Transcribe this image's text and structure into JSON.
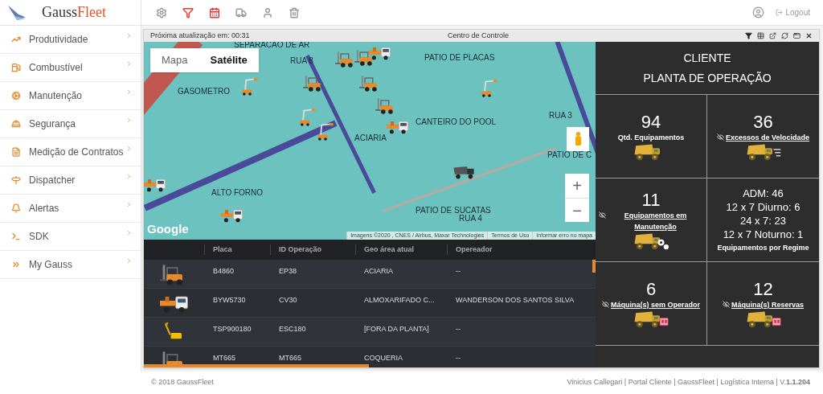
{
  "brand": {
    "name_first": "Gauss",
    "name_second": "Fleet"
  },
  "toolbar_icons": [
    {
      "active": false
    },
    {
      "active": true
    },
    {
      "active": true
    },
    {
      "active": false
    },
    {
      "active": false
    },
    {
      "active": false
    }
  ],
  "logout": "Logout",
  "sidebar": {
    "items": [
      {
        "label": "Produtividade"
      },
      {
        "label": "Combustível"
      },
      {
        "label": "Manutenção"
      },
      {
        "label": "Segurança"
      },
      {
        "label": "Medição de Contratos"
      },
      {
        "label": "Dispatcher"
      },
      {
        "label": "Alertas"
      },
      {
        "label": "SDK"
      },
      {
        "label": "My Gauss"
      }
    ]
  },
  "window": {
    "countdown": "Próxima atualização em: 00:31",
    "title": "Centro de Controle"
  },
  "map": {
    "types": [
      {
        "label": "Mapa",
        "selected": false
      },
      {
        "label": "Satélite",
        "selected": true
      }
    ],
    "labels": [
      "SEPARACAO DE AR",
      "RUA 8",
      "PATIO DE PLACAS",
      "GASOMETRO",
      "CANTEIRO DO POOL",
      "ACIARIA",
      "RUA 3",
      "PATIO DE C",
      "ALTO FORNO",
      "PATIO DE SUCATAS",
      "RUA 4"
    ],
    "zoom_in": "+",
    "zoom_out": "−",
    "logo": "Google",
    "attribution": [
      "Imagens ©2020 , CNES / Airbus, Maxar Technologies",
      "Termos de Uso",
      "Informar erro no mapa"
    ]
  },
  "table": {
    "columns": [
      "Placa",
      "ID Operação",
      "Geo área atual",
      "Opereador"
    ],
    "rows": [
      {
        "kind": "forklift",
        "cells": [
          "B4860",
          "EP38",
          "ACIARIA",
          "--"
        ]
      },
      {
        "kind": "truck",
        "cells": [
          "BYW5730",
          "CV30",
          "ALMOXARIFADO C...",
          "WANDERSON DOS SANTOS SILVA"
        ]
      },
      {
        "kind": "excavator",
        "cells": [
          "TSP900180",
          "ESC180",
          "[FORA DA PLANTA]",
          "--"
        ]
      },
      {
        "kind": "forklift",
        "cells": [
          "MT665",
          "MT665",
          "COQUERIA",
          "--"
        ]
      }
    ]
  },
  "panel": {
    "title_lines": [
      "CLIENTE",
      "PLANTA DE OPERAÇÃO"
    ],
    "cards": [
      {
        "kind": "stat",
        "value": "94",
        "label": "Qtd. Equipamentos",
        "link": false,
        "icon": {
          "kind": "plain"
        }
      },
      {
        "kind": "stat",
        "value": "36",
        "label": "Excessos de Velocidade",
        "link": true,
        "icon": {
          "kind": "speed"
        }
      },
      {
        "kind": "stat",
        "value": "11",
        "label": "Equipamentos em Manutenção",
        "link": true,
        "icon": {
          "kind": "gears"
        }
      },
      {
        "kind": "regime",
        "lines": [
          "ADM: 46",
          "12 x 7 Diurno: 6",
          "24 x 7: 23",
          "12 x 7 Noturno: 1"
        ],
        "label": "Equipamentos por Regime"
      },
      {
        "kind": "stat",
        "value": "6",
        "label": "Máquina(s) sem Operador",
        "link": true,
        "icon": {
          "kind": "operator"
        }
      },
      {
        "kind": "stat",
        "value": "12",
        "label": "Máquina(s) Reservas",
        "link": true,
        "icon": {
          "kind": "operator"
        }
      }
    ]
  },
  "footer": {
    "copyright": "© 2018 GaussFleet",
    "info": "Vinicius Callegari | Portal Cliente | GaussFleet | Logística Interna | V.**1.1.204**"
  }
}
